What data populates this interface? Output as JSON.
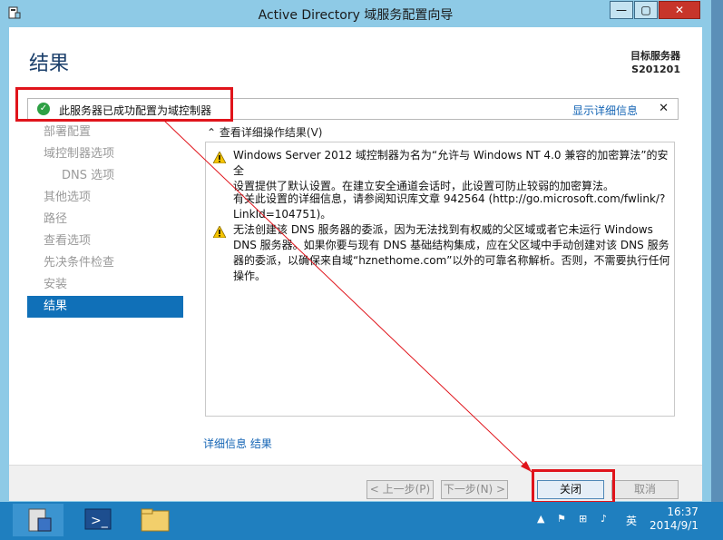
{
  "window": {
    "title": "Active Directory 域服务配置向导",
    "min_glyph": "—",
    "max_glyph": "▢",
    "close_glyph": "✕"
  },
  "page": {
    "title": "结果",
    "target_label": "目标服务器",
    "target_server": "S201201"
  },
  "notice": {
    "message": "此服务器已成功配置为域控制器",
    "detail_link": "显示详细信息",
    "close_glyph": "✕"
  },
  "nav": {
    "items": [
      {
        "label": "部署配置"
      },
      {
        "label": "域控制器选项"
      },
      {
        "label": "DNS 选项"
      },
      {
        "label": "其他选项"
      },
      {
        "label": "路径"
      },
      {
        "label": "查看选项"
      },
      {
        "label": "先决条件检查"
      },
      {
        "label": "安装"
      },
      {
        "label": "结果"
      }
    ]
  },
  "details": {
    "toggle": "查看详细操作结果(V)",
    "messages": [
      {
        "line1": "Windows Server 2012 域控制器为名为“允许与 Windows NT 4.0 兼容的加密算法”的安全",
        "line2": "设置提供了默认设置。在建立安全通道会话时，此设置可防止较弱的加密算法。"
      },
      {
        "line1": "有关此设置的详细信息，请参阅知识库文章 942564 (http://go.microsoft.com/fwlink/?",
        "line2": "LinkId=104751)。"
      },
      {
        "line1": "无法创建该 DNS 服务器的委派，因为无法找到有权威的父区域或者它未运行 Windows",
        "line2": "DNS 服务器。如果你要与现有 DNS 基础结构集成，应在父区域中手动创建对该 DNS 服务",
        "line3": "器的委派，以确保来自域“hznethome.com”以外的可靠名称解析。否则，不需要执行任何",
        "line4": "操作。"
      }
    ],
    "more_link": "详细信息 结果"
  },
  "footer": {
    "prev": "< 上一步(P)",
    "next": "下一步(N) >",
    "close": "关闭",
    "cancel": "取消"
  },
  "taskbar": {
    "ime": "英",
    "time": "16:37",
    "date": "2014/9/1"
  },
  "colors": {
    "accent": "#1070b8",
    "highlight": "#e0141b",
    "success": "#2ea044",
    "warning": "#f5c400",
    "link": "#1565b5"
  }
}
